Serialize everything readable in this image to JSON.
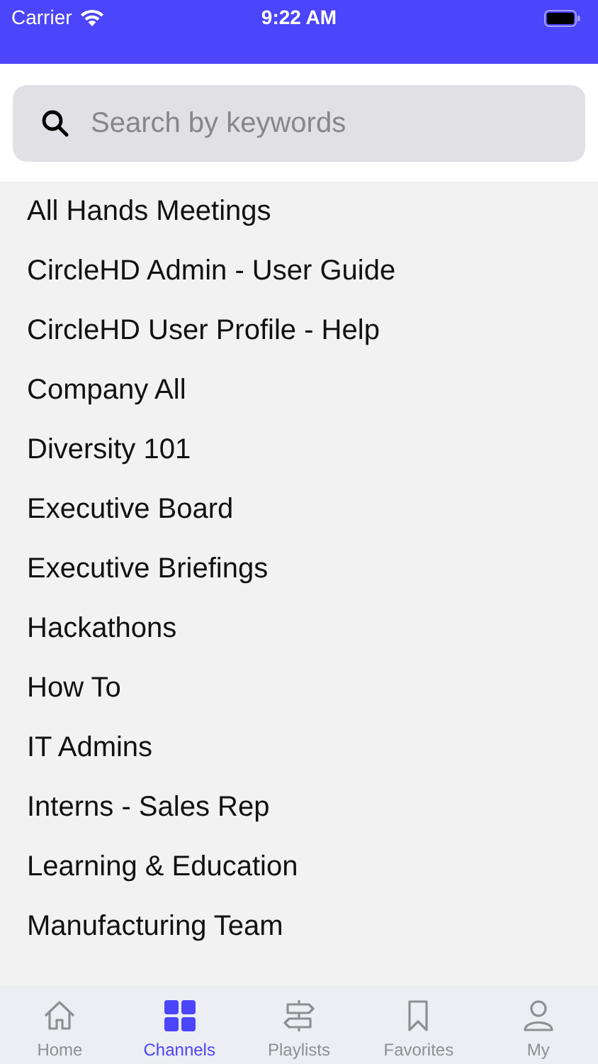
{
  "status_bar": {
    "carrier": "Carrier",
    "time": "9:22 AM"
  },
  "search": {
    "placeholder": "Search by keywords"
  },
  "channels": [
    "All Hands Meetings",
    "CircleHD Admin - User Guide",
    "CircleHD User Profile - Help",
    "Company All",
    "Diversity 101",
    "Executive Board",
    "Executive Briefings",
    "Hackathons",
    "How To",
    "IT Admins",
    "Interns - Sales Rep",
    "Learning & Education",
    "Manufacturing Team"
  ],
  "tab_bar": [
    {
      "label": "Home",
      "kind": "home",
      "selected": false
    },
    {
      "label": "Channels",
      "kind": "channels",
      "selected": true
    },
    {
      "label": "Playlists",
      "kind": "playlists",
      "selected": false
    },
    {
      "label": "Favorites",
      "kind": "favorites",
      "selected": false
    },
    {
      "label": "My",
      "kind": "profile",
      "selected": false
    }
  ]
}
